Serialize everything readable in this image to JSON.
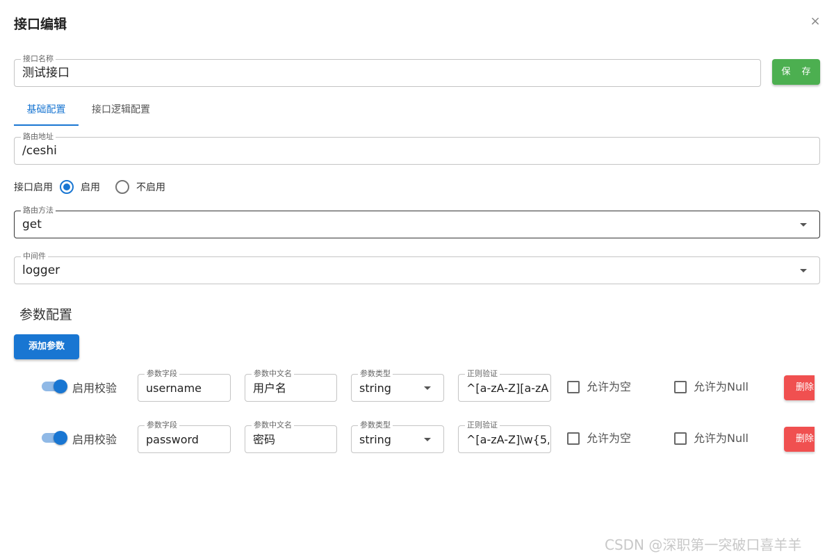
{
  "dialog": {
    "title": "接口编辑",
    "close_icon": "×"
  },
  "api_name": {
    "label": "接口名称",
    "value": "测试接口"
  },
  "save_label": "保 存",
  "tabs": [
    {
      "label": "基础配置",
      "active": true
    },
    {
      "label": "接口逻辑配置",
      "active": false
    }
  ],
  "route": {
    "label": "路由地址",
    "value": "/ceshi"
  },
  "enable": {
    "label": "接口启用",
    "options": [
      {
        "label": "启用",
        "checked": true
      },
      {
        "label": "不启用",
        "checked": false
      }
    ]
  },
  "method": {
    "label": "路由方法",
    "value": "get"
  },
  "middleware": {
    "label": "中间件",
    "value": "logger"
  },
  "params_section": {
    "title": "参数配置",
    "add_label": "添加参数"
  },
  "params": [
    {
      "validate_label": "启用校验",
      "field": {
        "label": "参数字段",
        "value": "username"
      },
      "cn_name": {
        "label": "参数中文名",
        "value": "用户名"
      },
      "type": {
        "label": "参数类型",
        "value": "string"
      },
      "regex": {
        "label": "正则验证",
        "value": "^[a-zA-Z][a-zA"
      },
      "allow_empty": "允许为空",
      "allow_null": "允许为Null",
      "delete_label": "删除"
    },
    {
      "validate_label": "启用校验",
      "field": {
        "label": "参数字段",
        "value": "password"
      },
      "cn_name": {
        "label": "参数中文名",
        "value": "密码"
      },
      "type": {
        "label": "参数类型",
        "value": "string"
      },
      "regex": {
        "label": "正则验证",
        "value": "^[a-zA-Z]\\w{5,"
      },
      "allow_empty": "允许为空",
      "allow_null": "允许为Null",
      "delete_label": "删除"
    }
  ],
  "watermark": "CSDN @深职第一突破口喜羊羊",
  "colors": {
    "primary": "#1976d2",
    "save": "#4caf50",
    "delete": "#f05050"
  }
}
